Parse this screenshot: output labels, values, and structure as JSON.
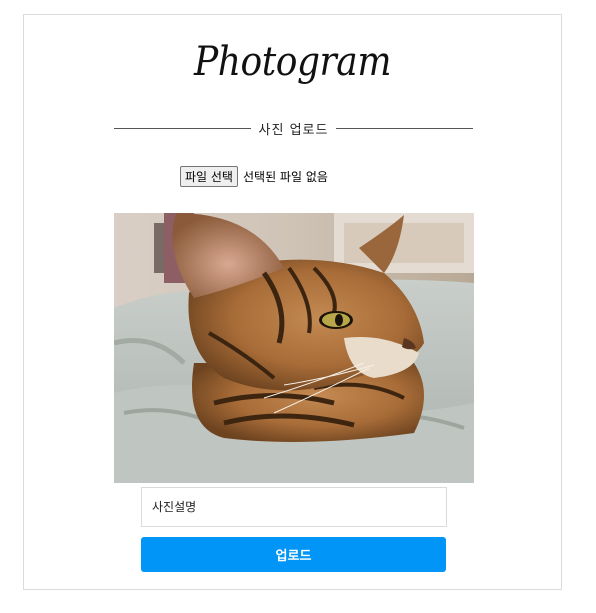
{
  "logo": {
    "text": "Photogram"
  },
  "section": {
    "title": "사진 업로드"
  },
  "file_input": {
    "button_label": "파일 선택",
    "status_text": "선택된 파일 없음"
  },
  "preview": {
    "subject": "tabby cat lying on bed"
  },
  "caption": {
    "placeholder": "사진설명",
    "value": ""
  },
  "upload": {
    "label": "업로드",
    "color": "#0095f6"
  }
}
